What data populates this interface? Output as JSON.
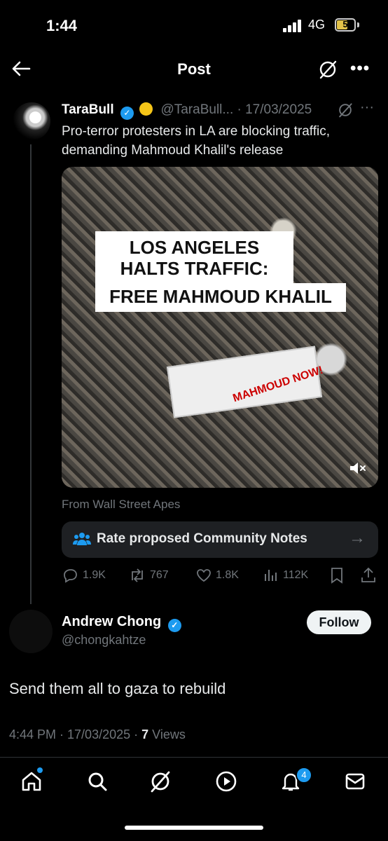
{
  "status": {
    "time": "1:44",
    "network": "4G",
    "battery": "5"
  },
  "header": {
    "title": "Post"
  },
  "post": {
    "author_name": "TaraBull",
    "handle_date": "@TaraBull... · 17/03/2025",
    "text": "Pro-terror protesters in LA are blocking traffic, demanding Mahmoud Khalil's release",
    "media_caption_line1": "LOS ANGELES",
    "media_caption_line2": "HALTS TRAFFIC:",
    "media_caption_line3": "FREE MAHMOUD KHALIL",
    "media_banner_text": "MAHMOUD NOW!",
    "source": "From Wall Street Apes",
    "community_notes_label": "Rate proposed Community Notes",
    "replies": "1.9K",
    "reposts": "767",
    "likes": "1.8K",
    "views": "112K"
  },
  "reply": {
    "author_name": "Andrew Chong",
    "handle": "@chongkahtze",
    "follow_label": "Follow",
    "text": "Send them all to gaza to rebuild",
    "timestamp": "4:44 PM · 17/03/2025 · ",
    "views_count": "7",
    "views_label": " Views"
  },
  "nav": {
    "notifications_badge": "4"
  },
  "colors": {
    "accent": "#1d9bf0",
    "background": "#000000",
    "muted": "#71767b"
  }
}
